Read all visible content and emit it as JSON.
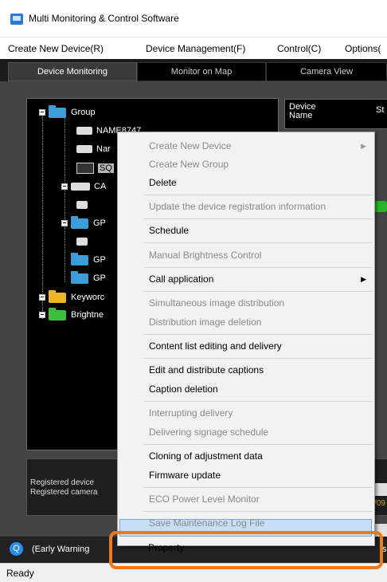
{
  "window": {
    "title": "Multi Monitoring & Control Software"
  },
  "menubar": {
    "items": [
      "Create New Device(R)",
      "Device Management(F)",
      "Control(C)",
      "Options("
    ]
  },
  "tabs": [
    "Device Monitoring",
    "Monitor on Map",
    "Camera View"
  ],
  "tree": {
    "group": "Group",
    "name_partial": "NAME8747",
    "na": "Nar",
    "sq": "SQ",
    "ca": "CA",
    "gp1": "GP",
    "gp2": "GP",
    "gp3": "GP",
    "keyword": "Keyworc",
    "brightness": "Brightne"
  },
  "grid": {
    "col_device": "Device",
    "col_name": "Name",
    "col_status": "St"
  },
  "info": {
    "registered_devices": "Registered device",
    "registered_cameras": "Registered camera",
    "date_fragment": "/09"
  },
  "early_warning": {
    "label": "(Early Warning",
    "tail": "s"
  },
  "status": {
    "text": "Ready"
  },
  "context_menu": {
    "items": [
      {
        "label": "Create New Device",
        "disabled": true,
        "submenu": true
      },
      {
        "label": "Create New Group",
        "disabled": true
      },
      {
        "label": "Delete",
        "disabled": false
      },
      {
        "label": "Update the device registration information",
        "disabled": true
      },
      {
        "label": "Schedule",
        "disabled": false
      },
      {
        "label": "Manual Brightness Control",
        "disabled": true
      },
      {
        "label": "Call application",
        "disabled": false,
        "submenu": true
      },
      {
        "label": "Simultaneous image distribution",
        "disabled": true
      },
      {
        "label": "Distribution image deletion",
        "disabled": true
      },
      {
        "label": "Content list editing and delivery",
        "disabled": false
      },
      {
        "label": "Edit and distribute captions",
        "disabled": false
      },
      {
        "label": "Caption deletion",
        "disabled": false
      },
      {
        "label": "Interrupting delivery",
        "disabled": true
      },
      {
        "label": "Delivering signage schedule",
        "disabled": true
      },
      {
        "label": "Cloning of adjustment data",
        "disabled": false
      },
      {
        "label": "Firmware update",
        "disabled": false
      },
      {
        "label": "ECO Power Level Monitor",
        "disabled": true
      },
      {
        "label": "Save Maintenance Log File",
        "disabled": true
      },
      {
        "label": "Property",
        "disabled": false,
        "highlighted": true
      }
    ]
  },
  "colors": {
    "highlight_outline": "#f07a1a",
    "selection": "#c7dff6"
  }
}
